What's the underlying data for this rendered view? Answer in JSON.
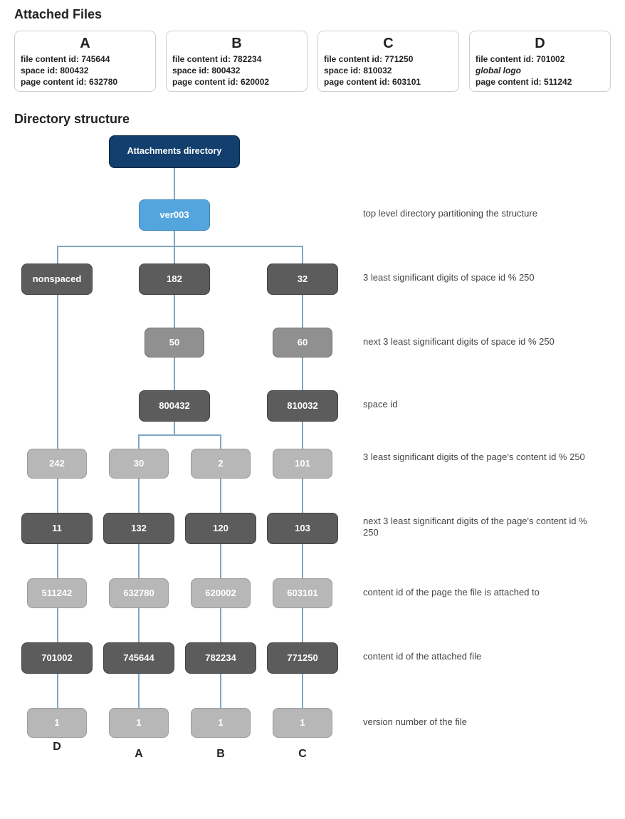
{
  "sections": {
    "attached_files_title": "Attached Files",
    "directory_structure_title": "Directory structure"
  },
  "file_cards": {
    "A": {
      "letter": "A",
      "line1_label": "file content id:",
      "line1_value": "745644",
      "line2_label": "space id:",
      "line2_value": "800432",
      "line3_label": "page content id:",
      "line3_value": "632780"
    },
    "B": {
      "letter": "B",
      "line1_label": "file content id:",
      "line1_value": "782234",
      "line2_label": "space id:",
      "line2_value": "800432",
      "line3_label": "page content id:",
      "line3_value": "620002"
    },
    "C": {
      "letter": "C",
      "line1_label": "file content id:",
      "line1_value": "771250",
      "line2_label": "space id:",
      "line2_value": "810032",
      "line3_label": "page content id:",
      "line3_value": "603101"
    },
    "D": {
      "letter": "D",
      "line1_label": "file content id:",
      "line1_value": "701002",
      "line2_italic": "global logo",
      "line3_label": "page content id:",
      "line3_value": "511242"
    }
  },
  "nodes": {
    "root": "Attachments directory",
    "ver": "ver003",
    "nonspaced": "nonspaced",
    "l1_val": "182",
    "l1_valC": "32",
    "l2_val": "50",
    "l2_valC": "60",
    "l3_val": "800432",
    "l3_valC": "810032",
    "pageMod_D": "242",
    "pageMod_A": "30",
    "pageMod_B": "2",
    "pageMod_C": "101",
    "pageMod2_D": "11",
    "pageMod2_A": "132",
    "pageMod2_B": "120",
    "pageMod2_C": "103",
    "pageId_D": "511242",
    "pageId_A": "632780",
    "pageId_B": "620002",
    "pageId_C": "603101",
    "fileId_D": "701002",
    "fileId_A": "745644",
    "fileId_B": "782234",
    "fileId_C": "771250",
    "ver_D": "1",
    "ver_A": "1",
    "ver_B": "1",
    "ver_C": "1"
  },
  "descriptions": {
    "d_ver": "top level directory partitioning the structure",
    "d_l1": "3 least significant digits of space id % 250",
    "d_l2": "next 3 least significant digits of space id % 250",
    "d_l3": "space id",
    "d_pageMod": "3 least significant digits of the page's content id % 250",
    "d_pageMod2": "next 3 least significant digits of the page's content id % 250",
    "d_pageId": "content id of the page the file is attached to",
    "d_fileId": "content id of the attached file",
    "d_verNum": "version number of the file"
  },
  "column_labels": {
    "D": "D",
    "A": "A",
    "B": "B",
    "C": "C"
  }
}
